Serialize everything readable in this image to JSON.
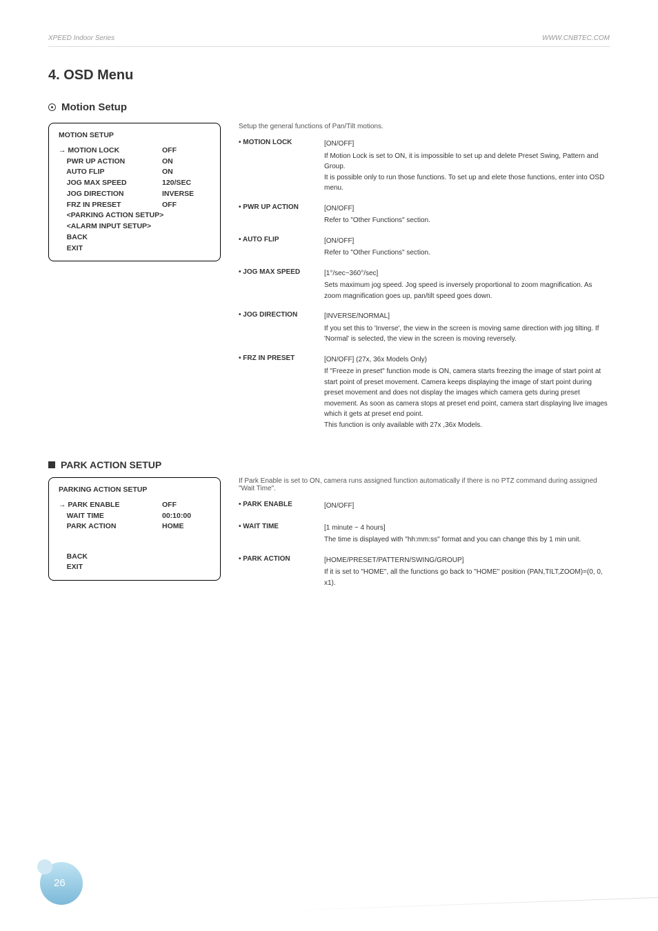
{
  "header": {
    "left": "XPEED Indoor Series",
    "right": "WWW.CNBTEC.COM"
  },
  "title": "4. OSD Menu",
  "section1": {
    "heading": "Motion Setup",
    "osd": {
      "title": "MOTION SETUP",
      "rows": [
        {
          "k": "→ MOTION LOCK",
          "v": "OFF"
        },
        {
          "k": "    PWR UP ACTION",
          "v": "ON"
        },
        {
          "k": "    AUTO FLIP",
          "v": "ON"
        },
        {
          "k": "    JOG MAX SPEED",
          "v": "120/SEC"
        },
        {
          "k": "    JOG DIRECTION",
          "v": "INVERSE"
        },
        {
          "k": "    FRZ IN PRESET",
          "v": "OFF"
        },
        {
          "k": "    <PARKING ACTION SETUP>",
          "v": ""
        },
        {
          "k": "    <ALARM INPUT SETUP>",
          "v": ""
        },
        {
          "k": "    BACK",
          "v": ""
        },
        {
          "k": "    EXIT",
          "v": ""
        }
      ]
    },
    "intro": "Setup the general functions of Pan/Tilt motions.",
    "items": [
      {
        "label": "• MOTION LOCK",
        "opt": "[ON/OFF]",
        "body": "If Motion Lock is set to ON, it is impossible to set up and delete Preset Swing, Pattern and Group.\nIt is possible only to run those functions. To set up and elete those functions, enter into OSD menu."
      },
      {
        "label": "• PWR UP ACTION",
        "opt": "[ON/OFF]",
        "body": "Refer to \"Other Functions\" section."
      },
      {
        "label": "• AUTO FLIP",
        "opt": "[ON/OFF]",
        "body": "Refer to \"Other Functions\" section."
      },
      {
        "label": "• JOG MAX SPEED",
        "opt": "[1°/sec~360°/sec]",
        "body": "Sets maximum jog speed. Jog speed is inversely proportional to zoom magnification. As zoom magnification goes up, pan/tilt speed goes down."
      },
      {
        "label": "• JOG DIRECTION",
        "opt": "[INVERSE/NORMAL]",
        "body": "If you set this to 'Inverse', the view in the screen is moving same direction with jog tilting. If 'Normal' is selected, the view in the screen is moving reversely."
      },
      {
        "label": "• FRZ IN PRESET",
        "opt": "[ON/OFF] (27x, 36x Models Only)",
        "body": "If \"Freeze in preset\" function mode is ON, camera starts freezing the image of start point at start point of preset movement. Camera keeps displaying the image of start point during preset movement and does not display the images which camera gets during preset movement. As soon as camera stops at preset end point, camera start displaying live images which it gets at preset end point.\nThis function is only available with 27x ,36x Models."
      }
    ]
  },
  "section2": {
    "heading": "PARK ACTION SETUP",
    "osd": {
      "title": "PARKING ACTION SETUP",
      "rows": [
        {
          "k": "→ PARK ENABLE",
          "v": "OFF"
        },
        {
          "k": "    WAIT TIME",
          "v": "00:10:00"
        },
        {
          "k": "    PARK ACTION",
          "v": "HOME"
        }
      ],
      "tail": [
        {
          "k": "    BACK",
          "v": ""
        },
        {
          "k": "    EXIT",
          "v": ""
        }
      ]
    },
    "intro": "If Park Enable is set to ON, camera runs assigned function automatically if there is no PTZ command during assigned \"Wait Time\".",
    "items": [
      {
        "label": "• PARK ENABLE",
        "opt": "[ON/OFF]",
        "body": ""
      },
      {
        "label": "• WAIT TIME",
        "opt": "[1 minute ~ 4 hours]",
        "body": "The time is displayed with \"hh:mm:ss\" format and you can change this by 1 min unit."
      },
      {
        "label": "• PARK ACTION",
        "opt": "[HOME/PRESET/PATTERN/SWING/GROUP]",
        "body": "If it is set to \"HOME\", all the functions go back to \"HOME\" position (PAN,TILT,ZOOM)=(0, 0, x1)."
      }
    ]
  },
  "pagenum": "26"
}
